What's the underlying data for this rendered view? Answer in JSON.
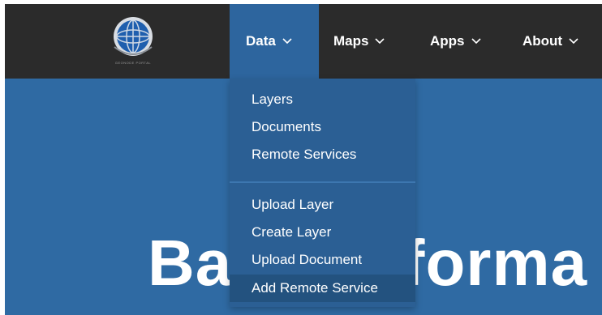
{
  "navbar": {
    "logo_caption": "GEONODE PORTAL",
    "items": [
      {
        "label": "Data"
      },
      {
        "label": "Maps"
      },
      {
        "label": "Apps"
      },
      {
        "label": "About"
      }
    ]
  },
  "dropdown": {
    "group1": [
      {
        "label": "Layers"
      },
      {
        "label": "Documents"
      },
      {
        "label": "Remote Services"
      }
    ],
    "group2": [
      {
        "label": "Upload Layer"
      },
      {
        "label": "Create Layer"
      },
      {
        "label": "Upload Document"
      },
      {
        "label": "Add Remote Service"
      }
    ]
  },
  "hero": {
    "title": "Basic Informa"
  },
  "colors": {
    "navbar_bg": "#2b2b2b",
    "hero_bg": "#2f6aa3",
    "dropdown_bg": "#2b5f94",
    "active_nav_bg": "#2d659e",
    "text": "#ffffff"
  }
}
